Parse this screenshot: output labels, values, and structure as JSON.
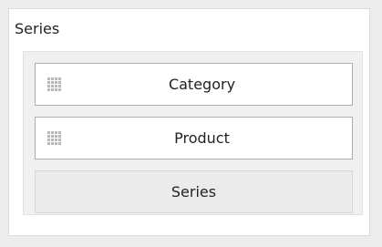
{
  "panel": {
    "title": "Series",
    "fields": [
      {
        "label": "Category",
        "icon": "drag-grip-icon"
      },
      {
        "label": "Product",
        "icon": "drag-grip-icon"
      }
    ],
    "placeholder_label": "Series"
  },
  "colors": {
    "background": "#ececec",
    "panel": "#ffffff",
    "drop_area": "#f0f0f0",
    "field_border": "#adadad",
    "text": "#222222"
  }
}
